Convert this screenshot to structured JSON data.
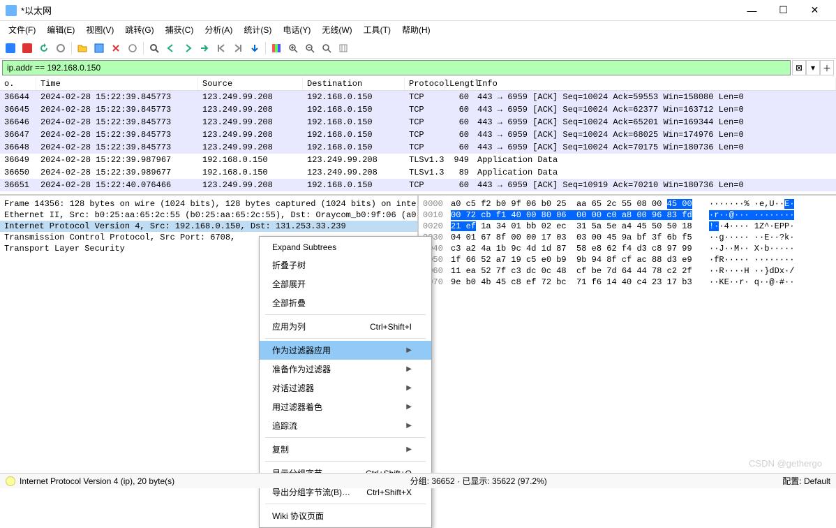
{
  "window_title": "*以太网",
  "menu": [
    "文件(F)",
    "编辑(E)",
    "视图(V)",
    "跳转(G)",
    "捕获(C)",
    "分析(A)",
    "统计(S)",
    "电话(Y)",
    "无线(W)",
    "工具(T)",
    "帮助(H)"
  ],
  "filter_text": "ip.addr == 192.168.0.150",
  "columns": {
    "no": "o.",
    "time": "Time",
    "src": "Source",
    "dst": "Destination",
    "proto": "Protocol",
    "len": "Lengtl",
    "info": "Info"
  },
  "packets": [
    {
      "no": "36644",
      "time": "2024-02-28 15:22:39.845773",
      "src": "123.249.99.208",
      "dst": "192.168.0.150",
      "proto": "TCP",
      "len": "60",
      "info": "443 → 6959 [ACK] Seq=10024 Ack=59553 Win=158080 Len=0",
      "cls": "lavender"
    },
    {
      "no": "36645",
      "time": "2024-02-28 15:22:39.845773",
      "src": "123.249.99.208",
      "dst": "192.168.0.150",
      "proto": "TCP",
      "len": "60",
      "info": "443 → 6959 [ACK] Seq=10024 Ack=62377 Win=163712 Len=0",
      "cls": "lavender"
    },
    {
      "no": "36646",
      "time": "2024-02-28 15:22:39.845773",
      "src": "123.249.99.208",
      "dst": "192.168.0.150",
      "proto": "TCP",
      "len": "60",
      "info": "443 → 6959 [ACK] Seq=10024 Ack=65201 Win=169344 Len=0",
      "cls": "lavender"
    },
    {
      "no": "36647",
      "time": "2024-02-28 15:22:39.845773",
      "src": "123.249.99.208",
      "dst": "192.168.0.150",
      "proto": "TCP",
      "len": "60",
      "info": "443 → 6959 [ACK] Seq=10024 Ack=68025 Win=174976 Len=0",
      "cls": "lavender"
    },
    {
      "no": "36648",
      "time": "2024-02-28 15:22:39.845773",
      "src": "123.249.99.208",
      "dst": "192.168.0.150",
      "proto": "TCP",
      "len": "60",
      "info": "443 → 6959 [ACK] Seq=10024 Ack=70175 Win=180736 Len=0",
      "cls": "lavender"
    },
    {
      "no": "36649",
      "time": "2024-02-28 15:22:39.987967",
      "src": "192.168.0.150",
      "dst": "123.249.99.208",
      "proto": "TLSv1.3",
      "len": "949",
      "info": "Application Data",
      "cls": ""
    },
    {
      "no": "36650",
      "time": "2024-02-28 15:22:39.989677",
      "src": "192.168.0.150",
      "dst": "123.249.99.208",
      "proto": "TLSv1.3",
      "len": "89",
      "info": "Application Data",
      "cls": ""
    },
    {
      "no": "36651",
      "time": "2024-02-28 15:22:40.076466",
      "src": "123.249.99.208",
      "dst": "192.168.0.150",
      "proto": "TCP",
      "len": "60",
      "info": "443 → 6959 [ACK] Seq=10919 Ack=70210 Win=180736 Len=0",
      "cls": "lavender"
    }
  ],
  "tree": [
    {
      "text": "Frame 14356: 128 bytes on wire (1024 bits), 128 bytes captured (1024 bits) on inte",
      "sel": false
    },
    {
      "text": "Ethernet II, Src: b0:25:aa:65:2c:55 (b0:25:aa:65:2c:55), Dst: Oraycom_b0:9f:06 (a0",
      "sel": false
    },
    {
      "text": "Internet Protocol Version 4, Src: 192.168.0.150, Dst: 131.253.33.239",
      "sel": true
    },
    {
      "text": "Transmission Control Protocol, Src Port: 6708,",
      "sel": false
    },
    {
      "text": "Transport Layer Security",
      "sel": false
    }
  ],
  "hex": [
    {
      "off": "0000",
      "b1": "a0 c5 f2 b0 9f 06 b0 25  aa 65 2c 55 08 00 ",
      "b2": "45 00",
      "a1": "·······% ·e,U··",
      "a2": "E·",
      "hl": 1
    },
    {
      "off": "0010",
      "b1": "",
      "b2": "00 72 cb f1 40 00 80 06  00 00 c0 a8 00 96 83 fd",
      "a1": "",
      "a2": "·r··@··· ········",
      "hl": 2
    },
    {
      "off": "0020",
      "b1": "",
      "b2": "21 ef",
      "b3": " 1a 34 01 bb 02 ec  31 5a 5e a4 45 50 50 18",
      "a1": "",
      "a2": "!·",
      "a3": "·4···· 1Z^·EPP·",
      "hl": 3
    },
    {
      "off": "0030",
      "b1": "04 01 67 8f 00 00 17 03  03 00 45 9a bf 3f 6b f5",
      "a": "··g····· ··E··?k·"
    },
    {
      "off": "0040",
      "b1": "c3 a2 4a 1b 9c 4d 1d 87  58 e8 62 f4 d3 c8 97 99",
      "a": "··J··M·· X·b·····"
    },
    {
      "off": "0050",
      "b1": "1f 66 52 a7 19 c5 e0 b9  9b 94 8f cf ac 88 d3 e9",
      "a": "·fR····· ········"
    },
    {
      "off": "0060",
      "b1": "11 ea 52 7f c3 dc 0c 48  cf be 7d 64 44 78 c2 2f",
      "a": "··R····H ··}dDx·/"
    },
    {
      "off": "0070",
      "b1": "9e b0 4b 45 c8 ef 72 bc  71 f6 14 40 c4 23 17 b3",
      "a": "··KE··r· q··@·#··"
    }
  ],
  "context_menu": [
    {
      "label": "Expand Subtrees",
      "shortcut": "",
      "arrow": false
    },
    {
      "label": "折叠子树",
      "shortcut": "",
      "arrow": false
    },
    {
      "label": "全部展开",
      "shortcut": "",
      "arrow": false
    },
    {
      "label": "全部折叠",
      "shortcut": "",
      "arrow": false
    },
    {
      "sep": true
    },
    {
      "label": "应用为列",
      "shortcut": "Ctrl+Shift+I",
      "arrow": false
    },
    {
      "sep": true
    },
    {
      "label": "作为过滤器应用",
      "shortcut": "",
      "arrow": true,
      "hl": true
    },
    {
      "label": "准备作为过滤器",
      "shortcut": "",
      "arrow": true
    },
    {
      "label": "对话过滤器",
      "shortcut": "",
      "arrow": true
    },
    {
      "label": "用过滤器着色",
      "shortcut": "",
      "arrow": true
    },
    {
      "label": "追踪流",
      "shortcut": "",
      "arrow": true
    },
    {
      "sep": true
    },
    {
      "label": "复制",
      "shortcut": "",
      "arrow": true
    },
    {
      "sep": true
    },
    {
      "label": "显示分组字节…",
      "shortcut": "Ctrl+Shift+O",
      "arrow": false
    },
    {
      "label": "导出分组字节流(B)…",
      "shortcut": "Ctrl+Shift+X",
      "arrow": false
    },
    {
      "sep": true
    },
    {
      "label": "Wiki 协议页面",
      "shortcut": "",
      "arrow": false
    }
  ],
  "status": {
    "left": "Internet Protocol Version 4 (ip), 20 byte(s)",
    "mid": "分组: 36652 · 已显示: 35622 (97.2%)",
    "right": "配置: Default"
  },
  "watermark": "CSDN @gethergo"
}
